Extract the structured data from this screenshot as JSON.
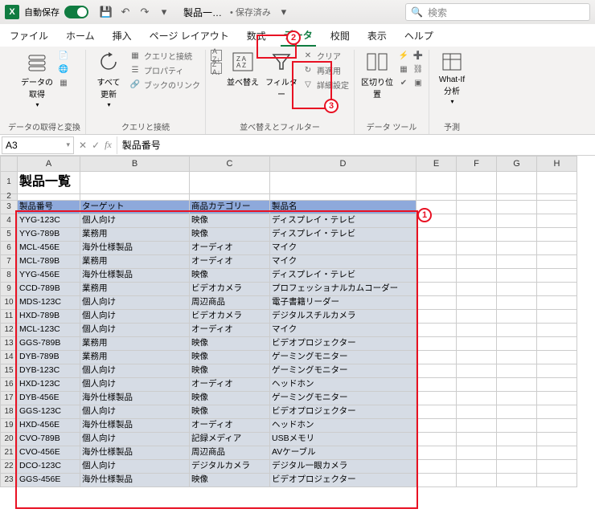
{
  "titlebar": {
    "autosave_label": "自動保存",
    "doc_name": "製品一…",
    "saved_status": "• 保存済み",
    "search_placeholder": "検索"
  },
  "tabs": {
    "file": "ファイル",
    "home": "ホーム",
    "insert": "挿入",
    "page_layout": "ページ レイアウト",
    "formulas": "数式",
    "data": "データ",
    "review": "校閲",
    "view": "表示",
    "help": "ヘルプ"
  },
  "ribbon": {
    "get_data": "データの\n取得",
    "refresh_all": "すべて\n更新",
    "queries_conn": "クエリと接続",
    "properties": "プロパティ",
    "workbook_links": "ブックのリンク",
    "sort": "並べ替え",
    "filter": "フィルター",
    "clear": "クリア",
    "reapply": "再適用",
    "advanced": "詳細設定",
    "text_to_cols": "区切り位置",
    "whatif": "What-If 分析",
    "group1": "データの取得と変換",
    "group2": "クエリと接続",
    "group3": "並べ替えとフィルター",
    "group4": "データ ツール",
    "group5": "予測"
  },
  "name_box": "A3",
  "formula_value": "製品番号",
  "columns": [
    "A",
    "B",
    "C",
    "D",
    "E",
    "F",
    "G",
    "H"
  ],
  "title_cell": "製品一覧",
  "table": {
    "headers": [
      "製品番号",
      "ターゲット",
      "商品カテゴリー",
      "製品名"
    ],
    "rows": [
      [
        "YYG-123C",
        "個人向け",
        "映像",
        "ディスプレイ・テレビ"
      ],
      [
        "YYG-789B",
        "業務用",
        "映像",
        "ディスプレイ・テレビ"
      ],
      [
        "MCL-456E",
        "海外仕様製品",
        "オーディオ",
        "マイク"
      ],
      [
        "MCL-789B",
        "業務用",
        "オーディオ",
        "マイク"
      ],
      [
        "YYG-456E",
        "海外仕様製品",
        "映像",
        "ディスプレイ・テレビ"
      ],
      [
        "CCD-789B",
        "業務用",
        "ビデオカメラ",
        "プロフェッショナルカムコーダー"
      ],
      [
        "MDS-123C",
        "個人向け",
        "周辺商品",
        "電子書籍リーダー"
      ],
      [
        "HXD-789B",
        "個人向け",
        "ビデオカメラ",
        "デジタルスチルカメラ"
      ],
      [
        "MCL-123C",
        "個人向け",
        "オーディオ",
        "マイク"
      ],
      [
        "GGS-789B",
        "業務用",
        "映像",
        "ビデオプロジェクター"
      ],
      [
        "DYB-789B",
        "業務用",
        "映像",
        "ゲーミングモニター"
      ],
      [
        "DYB-123C",
        "個人向け",
        "映像",
        "ゲーミングモニター"
      ],
      [
        "HXD-123C",
        "個人向け",
        "オーディオ",
        "ヘッドホン"
      ],
      [
        "DYB-456E",
        "海外仕様製品",
        "映像",
        "ゲーミングモニター"
      ],
      [
        "GGS-123C",
        "個人向け",
        "映像",
        "ビデオプロジェクター"
      ],
      [
        "HXD-456E",
        "海外仕様製品",
        "オーディオ",
        "ヘッドホン"
      ],
      [
        "CVO-789B",
        "個人向け",
        "記録メディア",
        "USBメモリ"
      ],
      [
        "CVO-456E",
        "海外仕様製品",
        "周辺商品",
        "AVケーブル"
      ],
      [
        "DCO-123C",
        "個人向け",
        "デジタルカメラ",
        "デジタル一眼カメラ"
      ],
      [
        "GGS-456E",
        "海外仕様製品",
        "映像",
        "ビデオプロジェクター"
      ]
    ]
  },
  "row_numbers": [
    "1",
    "2",
    "3",
    "4",
    "5",
    "6",
    "7",
    "8",
    "9",
    "10",
    "11",
    "12",
    "13",
    "14",
    "15",
    "16",
    "17",
    "18",
    "19",
    "20",
    "21",
    "22",
    "23"
  ],
  "annotations": {
    "a1": "1",
    "a2": "2",
    "a3": "3"
  }
}
